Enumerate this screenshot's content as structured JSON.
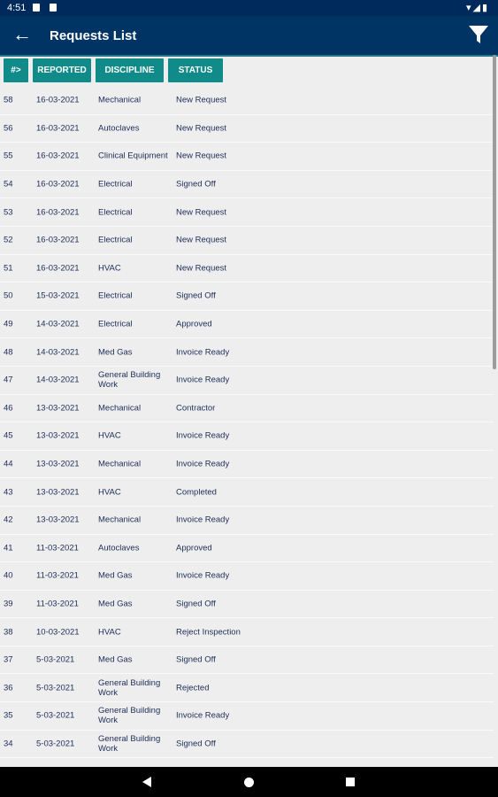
{
  "status_bar": {
    "time": "4:51",
    "icons": [
      "wifi-icon",
      "signal-icon",
      "battery-icon"
    ]
  },
  "app_bar": {
    "title": "Requests List",
    "back_icon": "arrow-left-icon",
    "filter_icon": "filter-icon"
  },
  "table": {
    "headers": [
      "#>",
      "REPORTED",
      "DISCIPLINE",
      "STATUS"
    ],
    "rows": [
      [
        "58",
        "16-03-2021",
        "Mechanical",
        "New Request"
      ],
      [
        "56",
        "16-03-2021",
        "Autoclaves",
        "New Request"
      ],
      [
        "55",
        "16-03-2021",
        "Clinical Equipment",
        "New Request"
      ],
      [
        "54",
        "16-03-2021",
        "Electrical",
        "Signed Off"
      ],
      [
        "53",
        "16-03-2021",
        "Electrical",
        "New Request"
      ],
      [
        "52",
        "16-03-2021",
        "Electrical",
        "New Request"
      ],
      [
        "51",
        "16-03-2021",
        "HVAC",
        "New Request"
      ],
      [
        "50",
        "15-03-2021",
        "Electrical",
        "Signed Off"
      ],
      [
        "49",
        "14-03-2021",
        "Electrical",
        "Approved"
      ],
      [
        "48",
        "14-03-2021",
        "Med Gas",
        "Invoice Ready"
      ],
      [
        "47",
        "14-03-2021",
        "General Building Work",
        "Invoice Ready"
      ],
      [
        "46",
        "13-03-2021",
        "Mechanical",
        "Contractor"
      ],
      [
        "45",
        "13-03-2021",
        "HVAC",
        "Invoice Ready"
      ],
      [
        "44",
        "13-03-2021",
        "Mechanical",
        "Invoice Ready"
      ],
      [
        "43",
        "13-03-2021",
        "HVAC",
        "Completed"
      ],
      [
        "42",
        "13-03-2021",
        "Mechanical",
        "Invoice Ready"
      ],
      [
        "41",
        "11-03-2021",
        "Autoclaves",
        "Approved"
      ],
      [
        "40",
        "11-03-2021",
        "Med Gas",
        "Invoice Ready"
      ],
      [
        "39",
        "11-03-2021",
        "Med Gas",
        "Signed Off"
      ],
      [
        "38",
        "10-03-2021",
        "HVAC",
        "Reject Inspection"
      ],
      [
        "37",
        "5-03-2021",
        "Med Gas",
        "Signed Off"
      ],
      [
        "36",
        "5-03-2021",
        "General Building Work",
        "Rejected"
      ],
      [
        "35",
        "5-03-2021",
        "General Building Work",
        "Invoice Ready"
      ],
      [
        "34",
        "5-03-2021",
        "General Building Work",
        "Signed Off"
      ]
    ]
  },
  "colors": {
    "app_bar": "#003465",
    "header_button": "#118a8a",
    "text": "#1e2d57",
    "background": "#eeeeee"
  }
}
